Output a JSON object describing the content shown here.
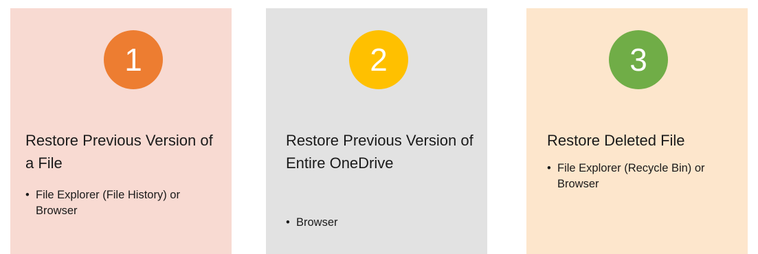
{
  "cards": [
    {
      "number": "1",
      "title": "Restore Previous Version of a File",
      "bullet": "File Explorer (File History) or Browser",
      "card_color": "#f8dad2",
      "badge_color": "#ed7d31"
    },
    {
      "number": "2",
      "title": "Restore Previous Version of Entire OneDrive",
      "bullet": "Browser",
      "card_color": "#e2e2e2",
      "badge_color": "#ffc000"
    },
    {
      "number": "3",
      "title": "Restore Deleted File",
      "bullet": "File Explorer (Recycle Bin) or Browser",
      "card_color": "#fde6cc",
      "badge_color": "#70ad47"
    }
  ],
  "bullet_glyph": "•"
}
